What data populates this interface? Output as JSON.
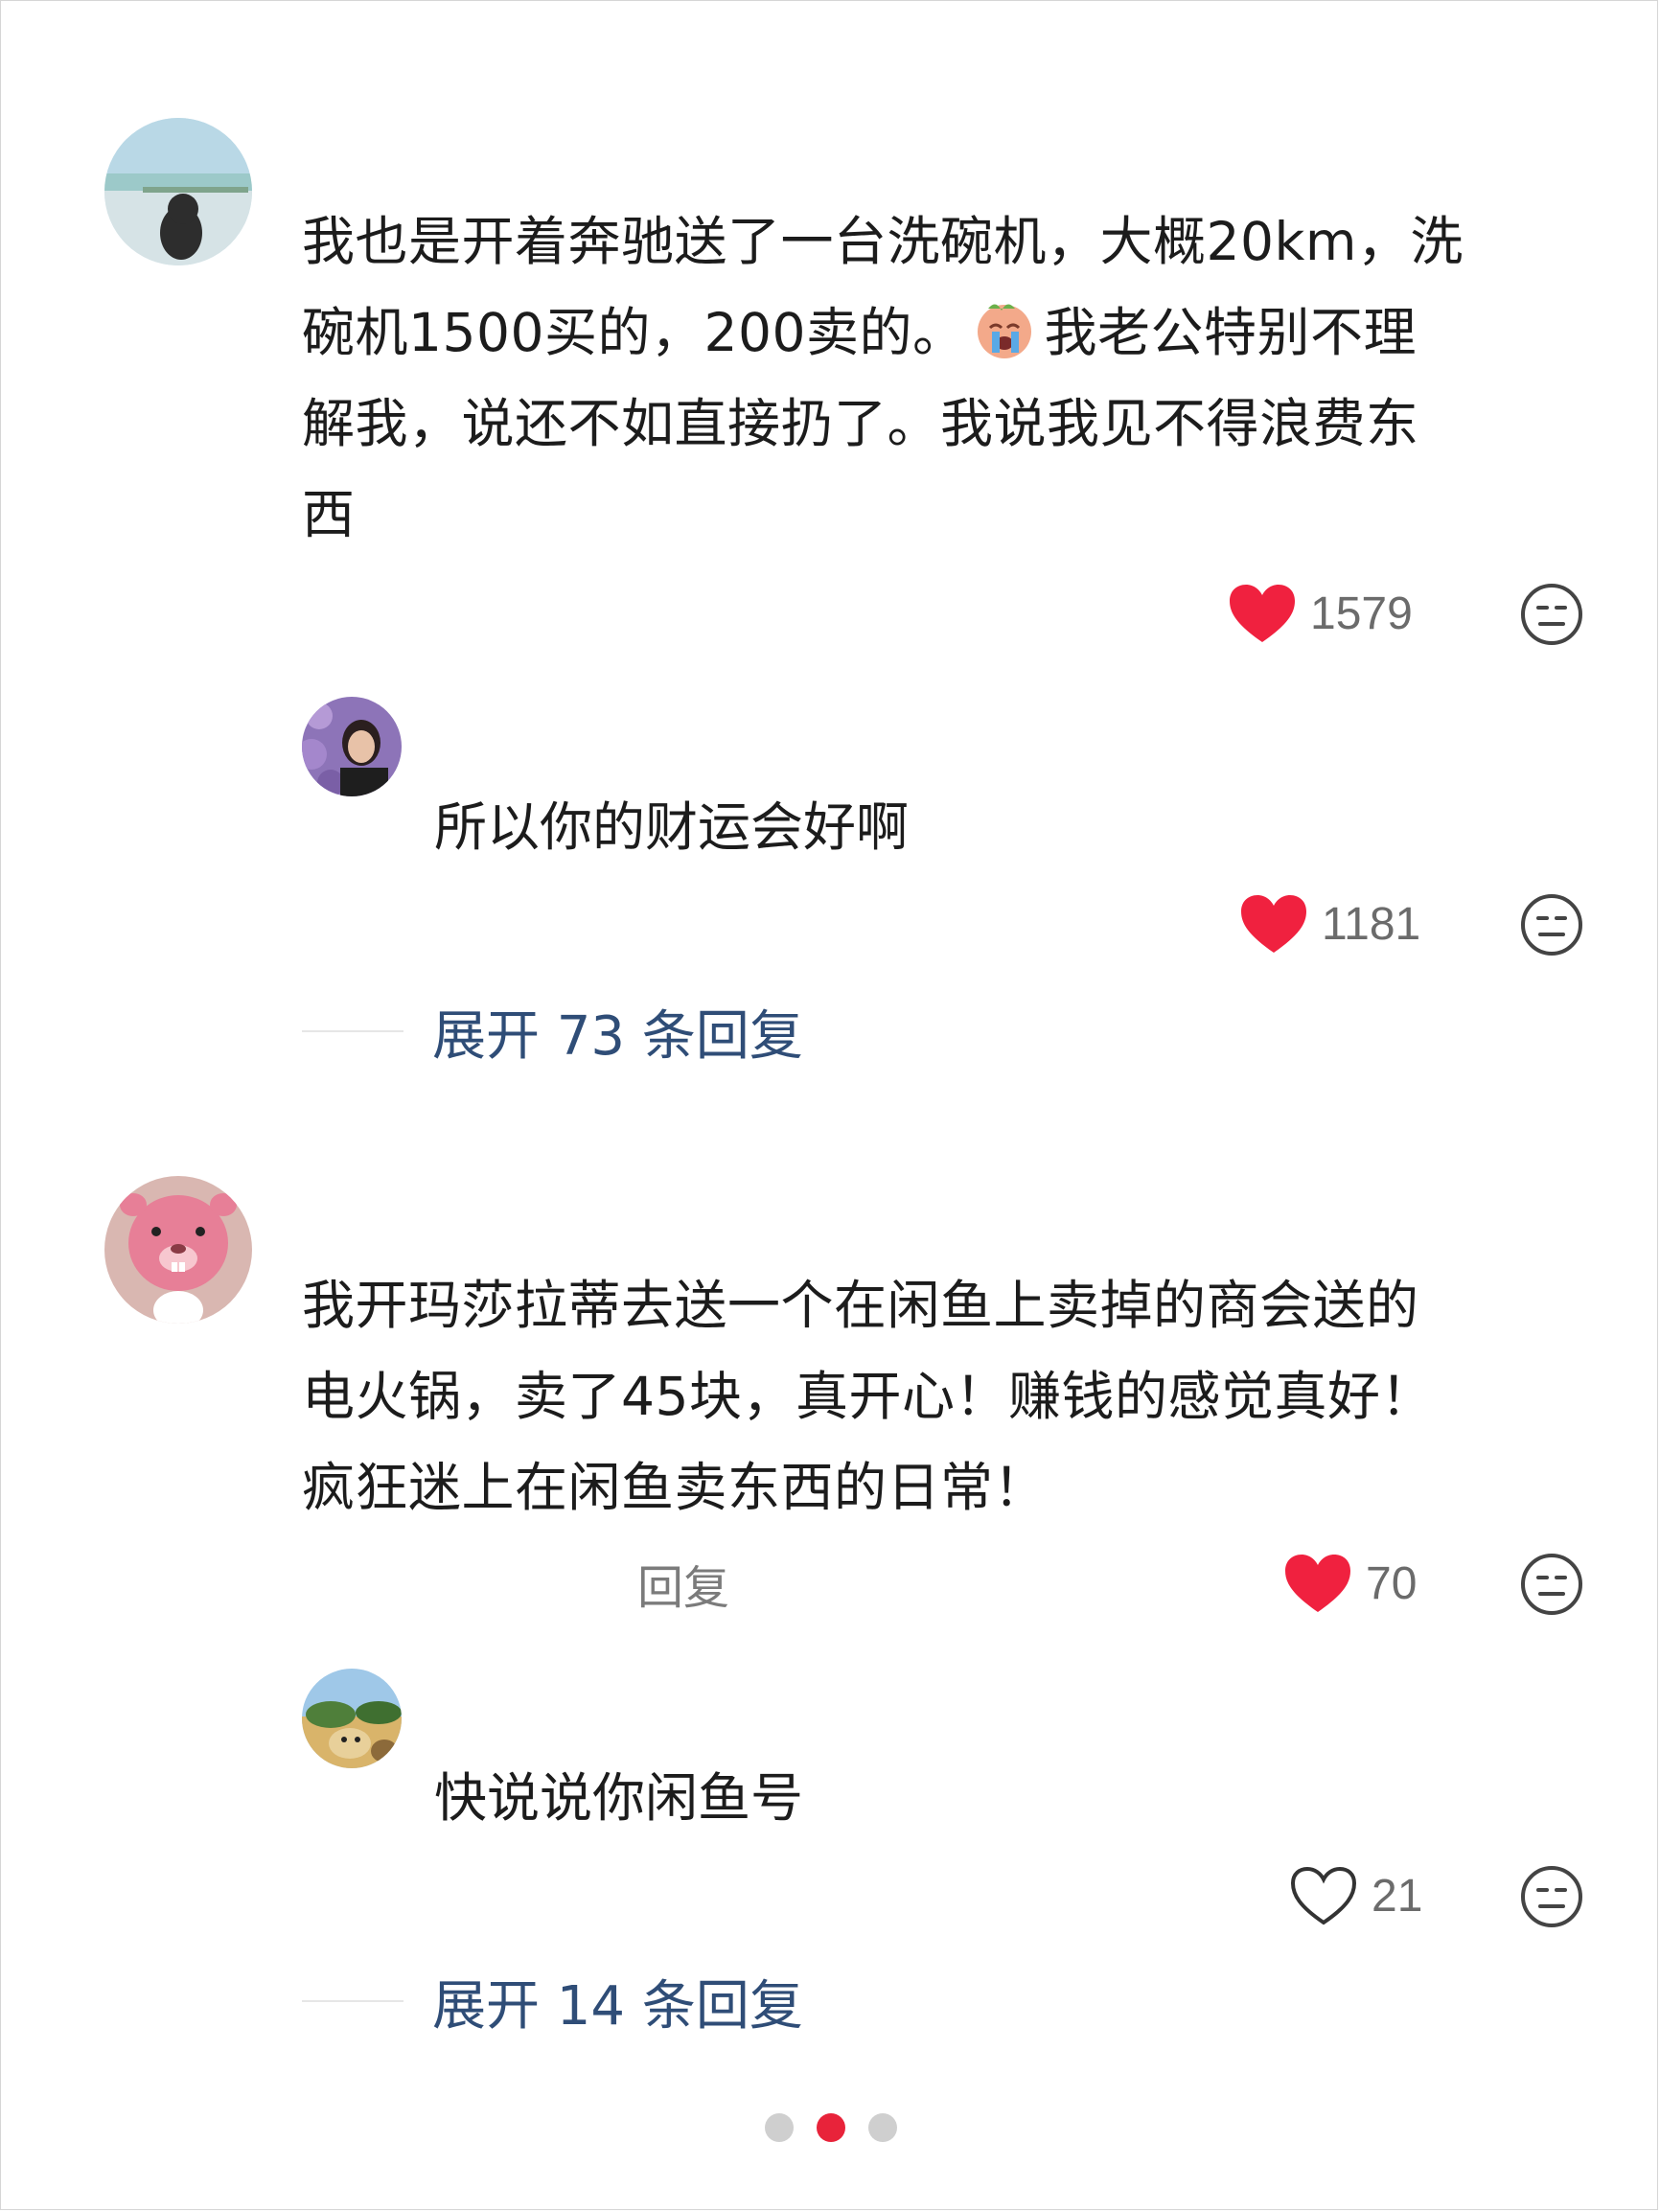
{
  "comments": [
    {
      "text_lines": [
        "我也是开着奔驰送了一台洗碗机，大概20km，洗",
        "碗机1500买的，200卖的。",
        "解我，说还不如直接扔了。我说我见不得浪费东",
        "西"
      ],
      "line2_after_emoji": "我老公特别不理",
      "emoji": "crying-face-emoji",
      "likes": "1579",
      "liked": true,
      "reply": {
        "text": "所以你的财运会好啊",
        "likes": "1181",
        "liked": true
      },
      "expand_label": "展开 73 条回复"
    },
    {
      "text_lines": [
        "我开玛莎拉蒂去送一个在闲鱼上卖掉的商会送的",
        "电火锅，卖了45块，真开心！赚钱的感觉真好！",
        "疯狂迷上在闲鱼卖东西的日常！"
      ],
      "reply_button": "回复",
      "likes": "70",
      "liked": true,
      "reply": {
        "text": "快说说你闲鱼号",
        "likes": "21",
        "liked": false
      },
      "expand_label": "展开 14 条回复"
    }
  ],
  "pagination": {
    "total": 3,
    "active_index": 1
  },
  "colors": {
    "like_red": "#f0213f",
    "expand_blue": "#2f4d77",
    "count_gray": "#6b6b6b",
    "dot_active": "#e8233a",
    "dot_inactive": "#cfcfcf"
  }
}
